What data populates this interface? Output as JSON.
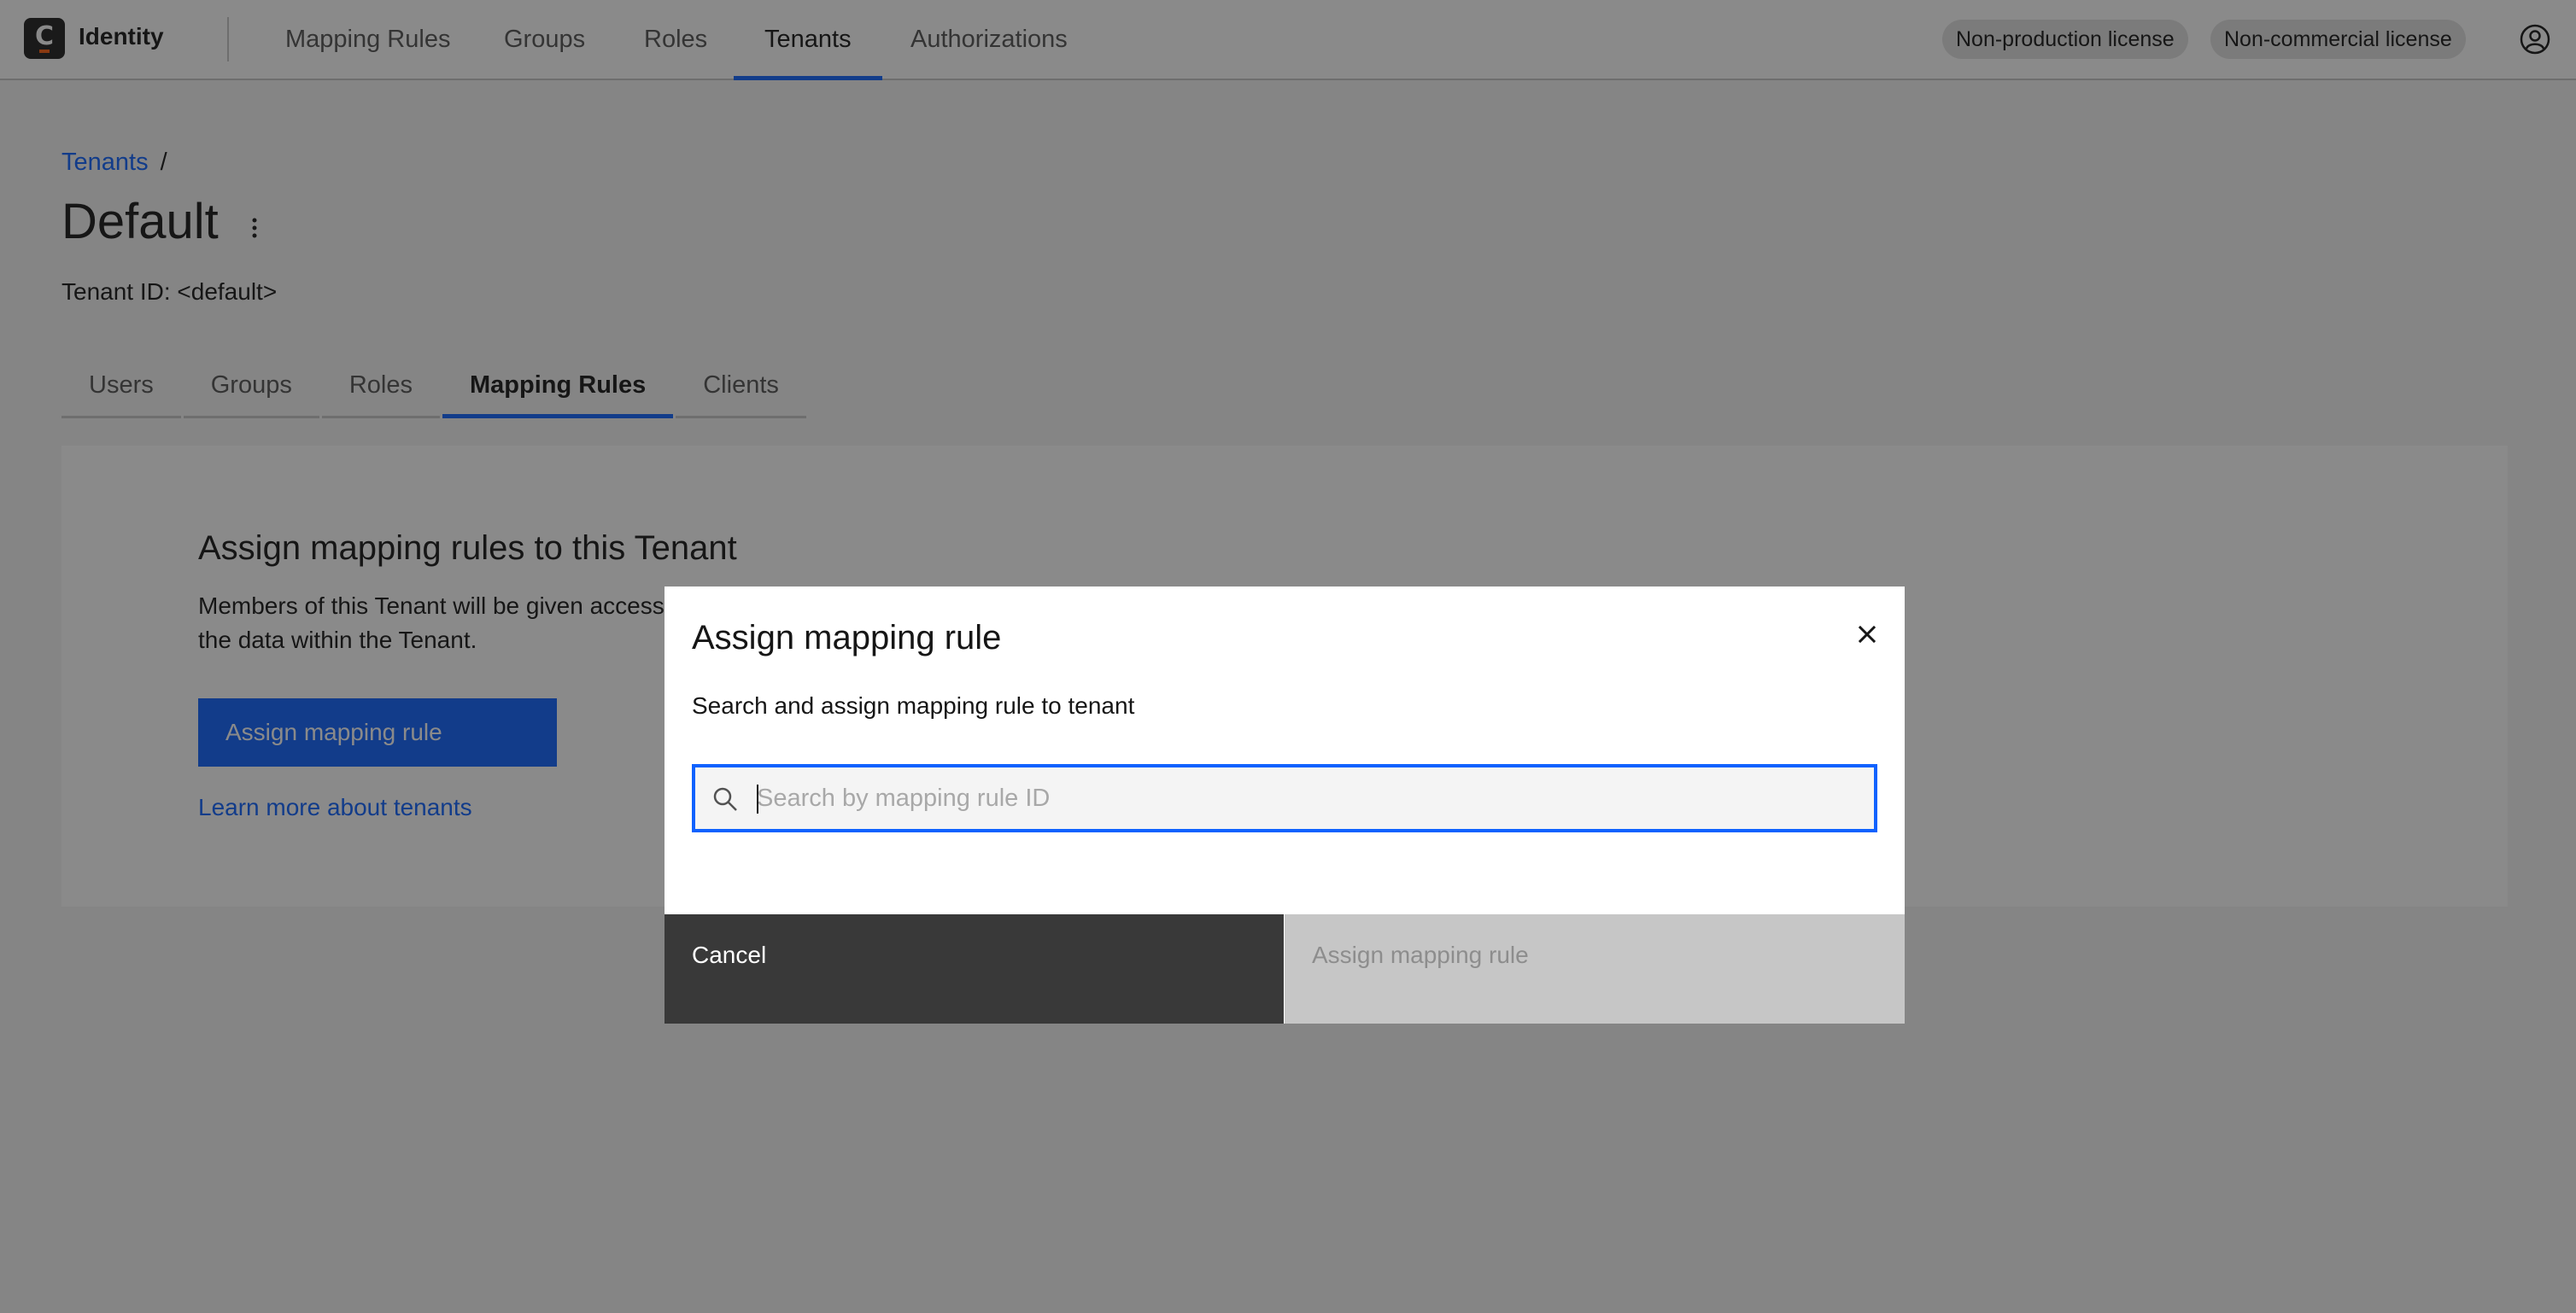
{
  "header": {
    "brand": "Identity",
    "logo_letter": "C",
    "nav": [
      "Mapping Rules",
      "Groups",
      "Roles",
      "Tenants",
      "Authorizations"
    ],
    "active_nav": "Tenants",
    "tags": [
      "Non-production license",
      "Non-commercial license"
    ],
    "colors": {
      "accent": "#0f62fe",
      "logo_bg": "#1e1e1e",
      "logo_bar": "#fc5d0d"
    }
  },
  "page": {
    "breadcrumb": {
      "link": "Tenants",
      "separator": "/"
    },
    "title": "Default",
    "tenant_id": "Tenant ID: <default>",
    "tabs": [
      "Users",
      "Groups",
      "Roles",
      "Mapping Rules",
      "Clients"
    ],
    "active_tab": "Mapping Rules",
    "empty_state": {
      "title": "Assign mapping rules to this Tenant",
      "description": "Members of this Tenant will be given access to the data within the Tenant.",
      "button": "Assign mapping rule",
      "link": "Learn more about tenants"
    }
  },
  "modal": {
    "title": "Assign mapping rule",
    "description": "Search and assign mapping rule to tenant",
    "search_placeholder": "Search by mapping rule ID",
    "search_value": "",
    "cancel_label": "Cancel",
    "submit_label": "Assign mapping rule"
  }
}
